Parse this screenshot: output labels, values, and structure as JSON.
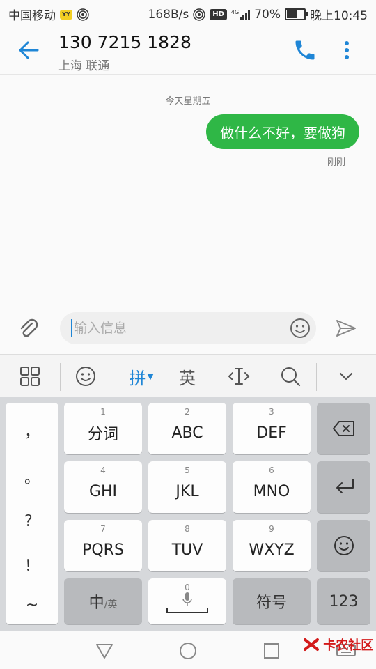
{
  "status": {
    "carrier": "中国移动",
    "speed": "168B/s",
    "signal_label": "4G",
    "battery": "70%",
    "battery_level": 0.7,
    "time": "晚上10:45"
  },
  "header": {
    "contact_number": "130 7215 1828",
    "contact_location": "上海 联通"
  },
  "conversation": {
    "date_separator": "今天星期五",
    "messages": [
      {
        "text": "做什么不好，要做狗",
        "time": "刚刚",
        "direction": "outgoing"
      }
    ]
  },
  "compose": {
    "placeholder": "输入信息"
  },
  "keyboard": {
    "toolbar": {
      "pinyin": "拼",
      "english": "英"
    },
    "punctuation": [
      "，",
      "。",
      "？",
      "！",
      "~"
    ],
    "keys": [
      {
        "num": "1",
        "label": "分词"
      },
      {
        "num": "2",
        "label": "ABC"
      },
      {
        "num": "3",
        "label": "DEF"
      },
      {
        "num": "4",
        "label": "GHI"
      },
      {
        "num": "5",
        "label": "JKL"
      },
      {
        "num": "6",
        "label": "MNO"
      },
      {
        "num": "7",
        "label": "PQRS"
      },
      {
        "num": "8",
        "label": "TUV"
      },
      {
        "num": "9",
        "label": "WXYZ"
      }
    ],
    "bottom": {
      "lang_main": "中",
      "lang_sub": "/英",
      "space_num": "0",
      "symbols": "符号",
      "numbers": "123"
    }
  },
  "watermark": "卡农社区",
  "colors": {
    "accent": "#1f86d6",
    "bubble": "#2fb746",
    "keyboard_bg": "#d6d8db"
  }
}
